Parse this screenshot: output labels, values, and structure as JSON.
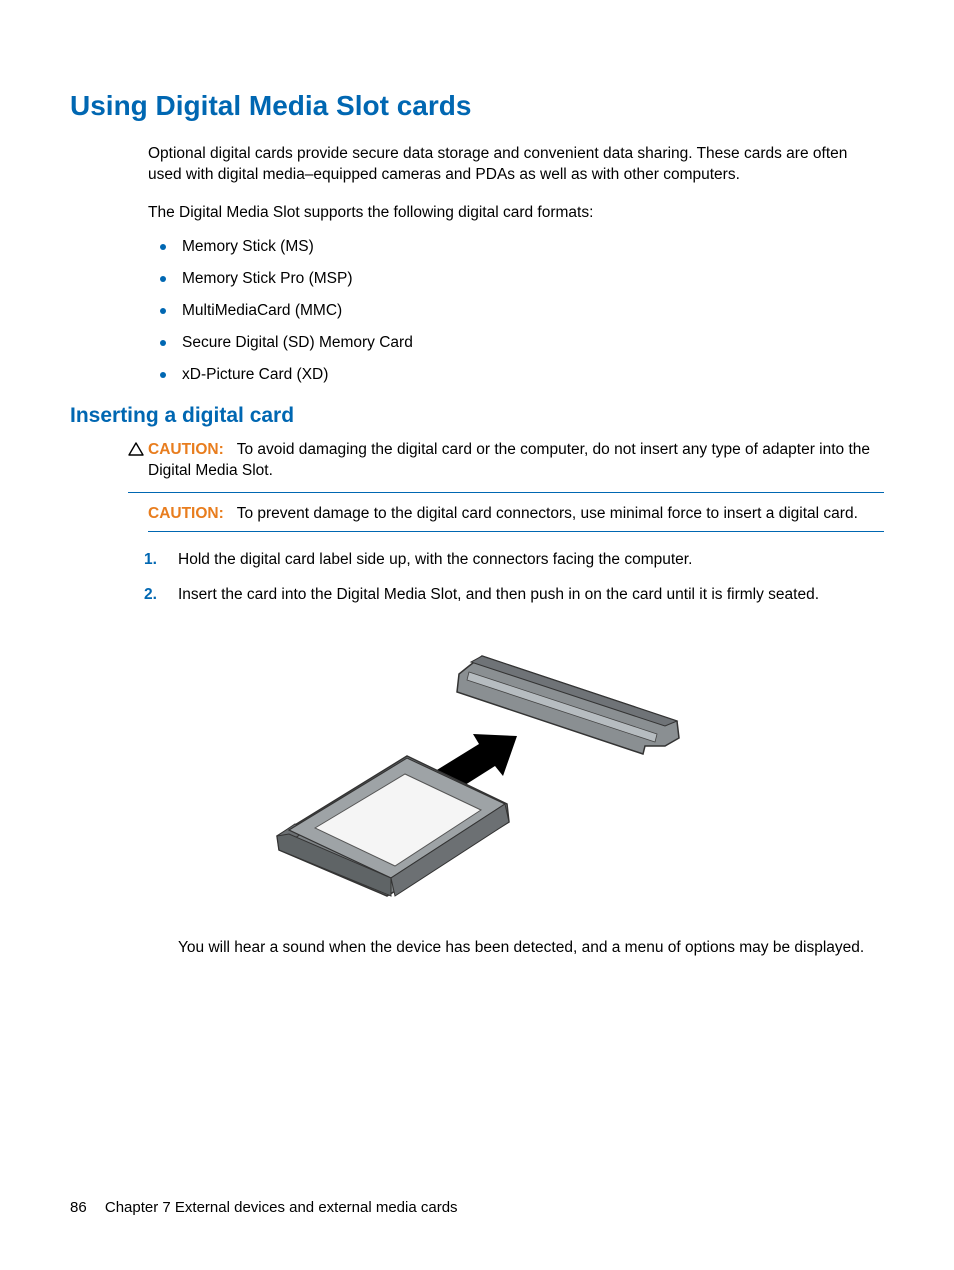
{
  "heading": "Using Digital Media Slot cards",
  "intro": "Optional digital cards provide secure data storage and convenient data sharing. These cards are often used with digital media–equipped cameras and PDAs as well as with other computers.",
  "lead": "The Digital Media Slot supports the following digital card formats:",
  "formats": [
    "Memory Stick (MS)",
    "Memory Stick Pro (MSP)",
    "MultiMediaCard (MMC)",
    "Secure Digital (SD) Memory Card",
    "xD-Picture Card (XD)"
  ],
  "subheading": "Inserting a digital card",
  "caution_label": "CAUTION:",
  "caution1": "To avoid damaging the digital card or the computer, do not insert any type of adapter into the Digital Media Slot.",
  "caution2": "To prevent damage to the digital card connectors, use minimal force to insert a digital card.",
  "steps": [
    {
      "n": "1.",
      "t": "Hold the digital card label side up, with the connectors facing the computer."
    },
    {
      "n": "2.",
      "t": "Insert the card into the Digital Media Slot, and then push in on the card until it is firmly seated."
    }
  ],
  "after_figure": "You will hear a sound when the device has been detected, and a menu of options may be displayed.",
  "footer": {
    "page": "86",
    "chapter": "Chapter 7   External devices and external media cards"
  }
}
